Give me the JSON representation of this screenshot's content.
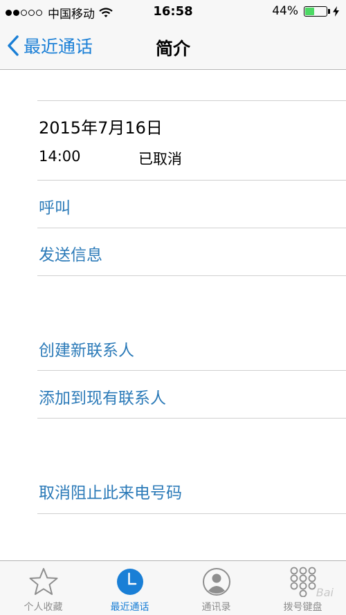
{
  "status_bar": {
    "carrier": "中国移动",
    "time": "16:58",
    "battery_percent": "44%",
    "battery_level": 0.44,
    "battery_color": "#4cd964"
  },
  "nav": {
    "back_label": "最近通话",
    "title": "简介"
  },
  "call": {
    "date": "2015年7月16日",
    "time": "14:00",
    "status": "已取消"
  },
  "actions": {
    "call": "呼叫",
    "send_message": "发送信息",
    "create_contact": "创建新联系人",
    "add_to_existing": "添加到现有联系人",
    "unblock": "取消阻止此来电号码"
  },
  "tabs": [
    {
      "label": "个人收藏",
      "icon": "star-icon"
    },
    {
      "label": "最近通话",
      "icon": "clock-icon"
    },
    {
      "label": "通讯录",
      "icon": "contacts-icon"
    },
    {
      "label": "拨号键盘",
      "icon": "keypad-icon"
    }
  ],
  "accent_color": "#1a7fd6",
  "watermark": "Bai"
}
